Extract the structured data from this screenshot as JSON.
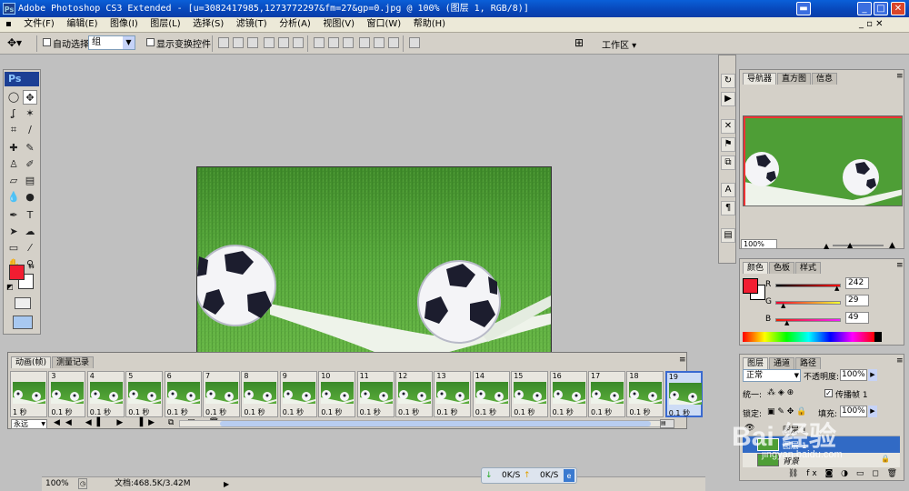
{
  "window": {
    "title": "Adobe Photoshop CS3 Extended - [u=3082417985,1273772297&fm=27&gp=0.jpg @ 100% (图层 1, RGB/8)]",
    "ps": "Ps"
  },
  "menu": [
    "文件(F)",
    "编辑(E)",
    "图像(I)",
    "图层(L)",
    "选择(S)",
    "滤镜(T)",
    "分析(A)",
    "视图(V)",
    "窗口(W)",
    "帮助(H)"
  ],
  "options": {
    "auto_select": "自动选择:",
    "group_value": "组",
    "show_transform": "显示变换控件",
    "workspace": "工作区"
  },
  "navigator": {
    "tabs": [
      "导航器",
      "直方图",
      "信息"
    ],
    "zoom": "100%"
  },
  "color": {
    "tabs": [
      "颜色",
      "色板",
      "样式"
    ],
    "r_label": "R",
    "g_label": "G",
    "b_label": "B",
    "r": "242",
    "g": "29",
    "b": "49",
    "fg": "#f21d31"
  },
  "layers": {
    "tabs": [
      "图层",
      "通道",
      "路径"
    ],
    "mode": "正常",
    "opacity_label": "不透明度:",
    "opacity": "100%",
    "lock_label": "锁定:",
    "fill_label": "填充:",
    "fill": "100%",
    "unify_label": "统一:",
    "propagate": "传播帧 1",
    "items": [
      "图层 1",
      "背景"
    ]
  },
  "animation": {
    "tabs": [
      "动画(帧)",
      "测量记录"
    ],
    "loop": "永远",
    "frames": [
      {
        "num": "",
        "delay": "1 秒"
      },
      {
        "num": "3",
        "delay": "0.1 秒"
      },
      {
        "num": "4",
        "delay": "0.1 秒"
      },
      {
        "num": "5",
        "delay": "0.1 秒"
      },
      {
        "num": "6",
        "delay": "0.1 秒"
      },
      {
        "num": "7",
        "delay": "0.1 秒"
      },
      {
        "num": "8",
        "delay": "0.1 秒"
      },
      {
        "num": "9",
        "delay": "0.1 秒"
      },
      {
        "num": "10",
        "delay": "0.1 秒"
      },
      {
        "num": "11",
        "delay": "0.1 秒"
      },
      {
        "num": "12",
        "delay": "0.1 秒"
      },
      {
        "num": "13",
        "delay": "0.1 秒"
      },
      {
        "num": "14",
        "delay": "0.1 秒"
      },
      {
        "num": "15",
        "delay": "0.1 秒"
      },
      {
        "num": "16",
        "delay": "0.1 秒"
      },
      {
        "num": "17",
        "delay": "0.1 秒"
      },
      {
        "num": "18",
        "delay": "0.1 秒"
      },
      {
        "num": "19",
        "delay": "0.1 秒"
      }
    ]
  },
  "status": {
    "zoom": "100%",
    "doc": "文档:468.5K/3.42M"
  },
  "net": {
    "down": "0K/S",
    "up": "0K/S"
  },
  "watermark": {
    "text": "Bai 经验",
    "url": "jingyan.baidu.com"
  }
}
